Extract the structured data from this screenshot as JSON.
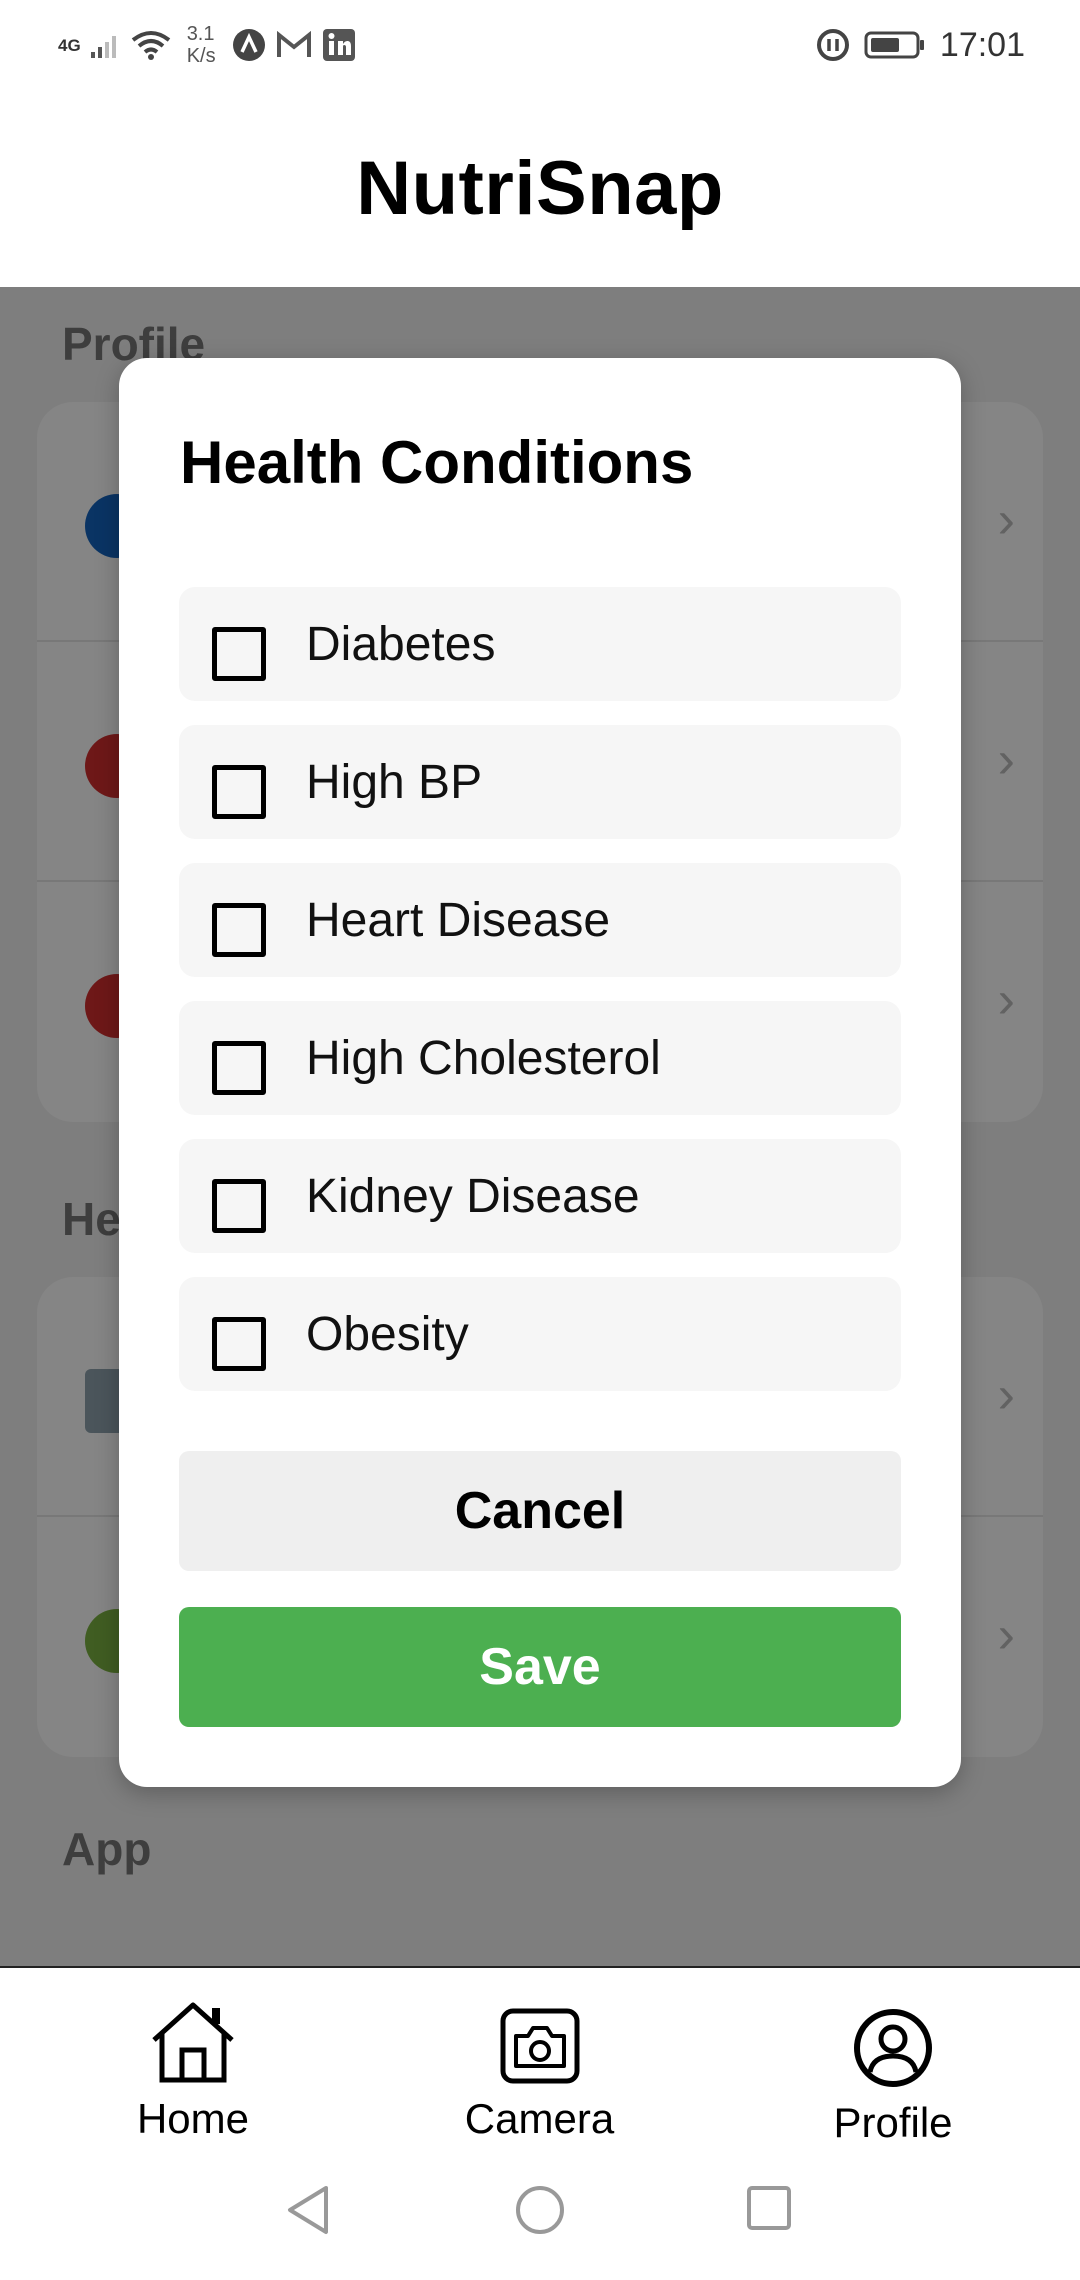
{
  "status_bar": {
    "network": "4G",
    "speed_value": "3.1",
    "speed_unit": "K/s",
    "clock": "17:01"
  },
  "app": {
    "title": "NutriSnap"
  },
  "background": {
    "sections": [
      {
        "label": "Profile"
      },
      {
        "label": "He"
      },
      {
        "label": "App"
      }
    ]
  },
  "modal": {
    "title": "Health Conditions",
    "options": [
      {
        "label": "Diabetes",
        "checked": false
      },
      {
        "label": "High BP",
        "checked": false
      },
      {
        "label": "Heart Disease",
        "checked": false
      },
      {
        "label": "High Cholesterol",
        "checked": false
      },
      {
        "label": "Kidney Disease",
        "checked": false
      },
      {
        "label": "Obesity",
        "checked": false
      }
    ],
    "cancel_label": "Cancel",
    "save_label": "Save"
  },
  "tabs": [
    {
      "label": "Home",
      "icon": "home-icon"
    },
    {
      "label": "Camera",
      "icon": "camera-icon"
    },
    {
      "label": "Profile",
      "icon": "profile-icon",
      "active": true
    }
  ],
  "colors": {
    "accent": "#4caf50",
    "overlay": "rgba(0,0,0,0.48)"
  }
}
